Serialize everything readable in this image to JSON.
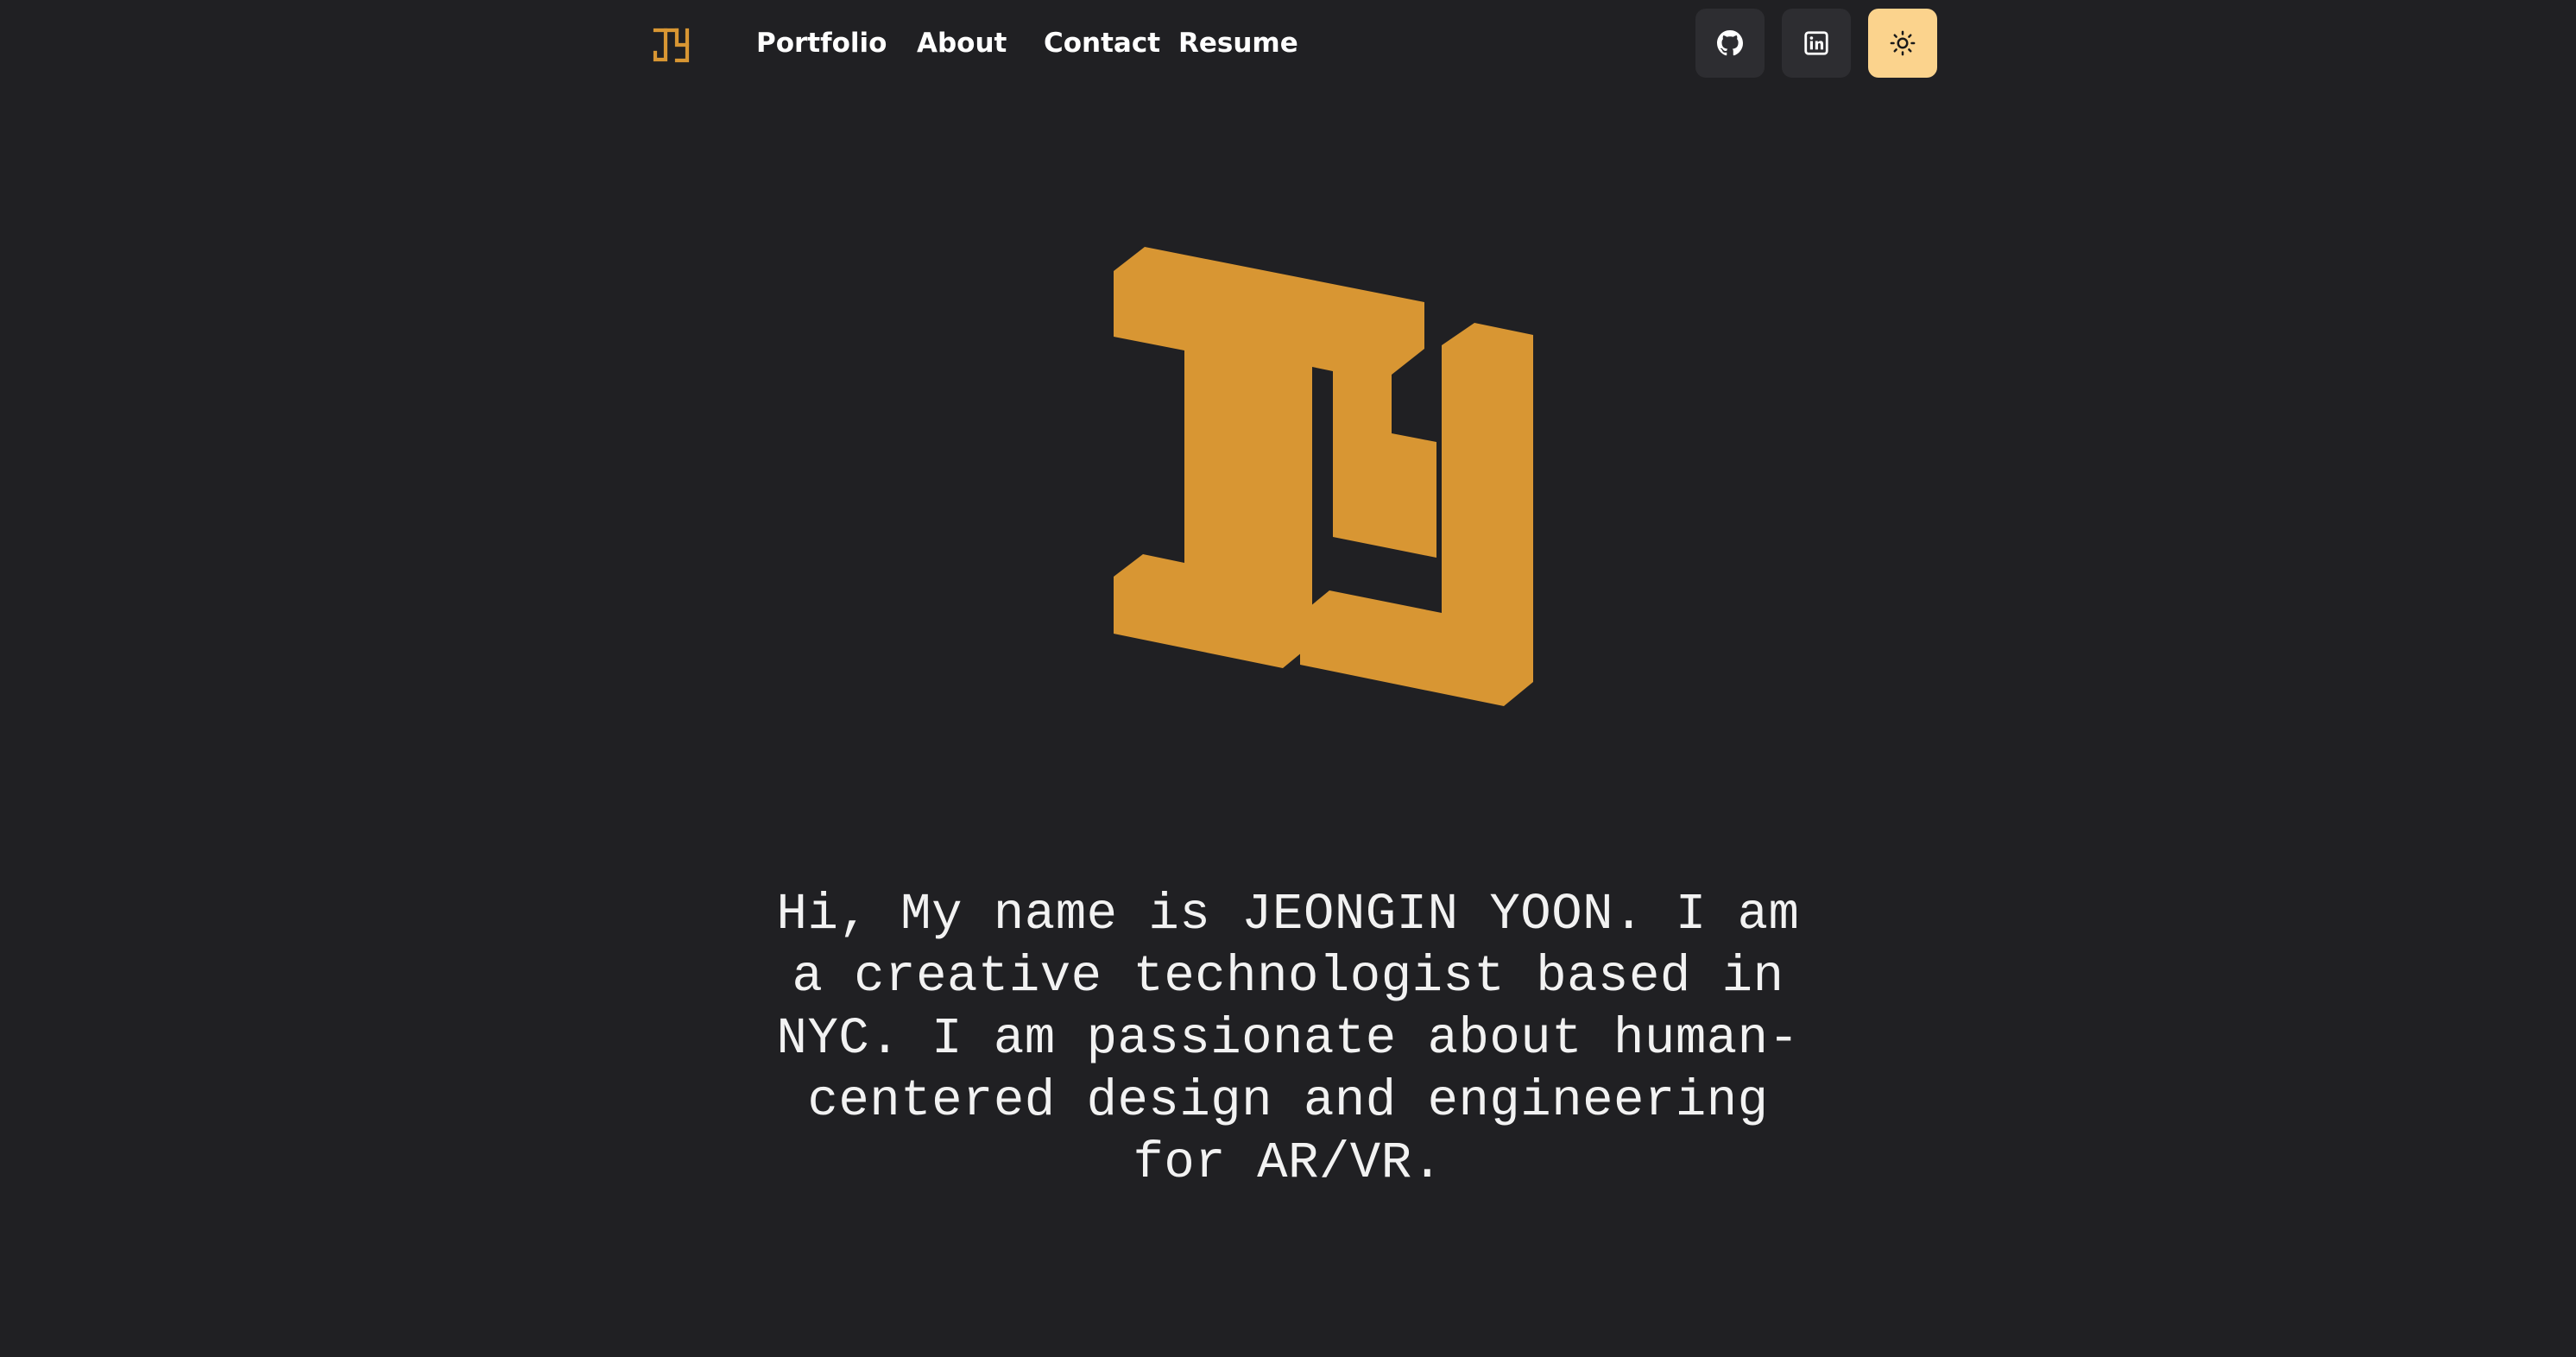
{
  "nav": {
    "logo_icon": "jy-monogram-logo-icon",
    "links": [
      "Portfolio",
      "About",
      "Contact",
      "Resume"
    ],
    "buttons": [
      {
        "icon": "github-icon"
      },
      {
        "icon": "linkedin-icon"
      },
      {
        "icon": "sun-icon"
      }
    ]
  },
  "hero": {
    "logo_icon": "jy-monogram-logo-icon",
    "intro_text": "Hi, My name is JEONGIN YOON. I am a creative technologist based in NYC. I am passionate about human-centered design and engineering for AR/VR."
  },
  "colors": {
    "background": "#202023",
    "accent": "#d89633",
    "theme_button": "#fbd38d",
    "icon_button": "#2d2d31",
    "text": "#ffffff"
  }
}
